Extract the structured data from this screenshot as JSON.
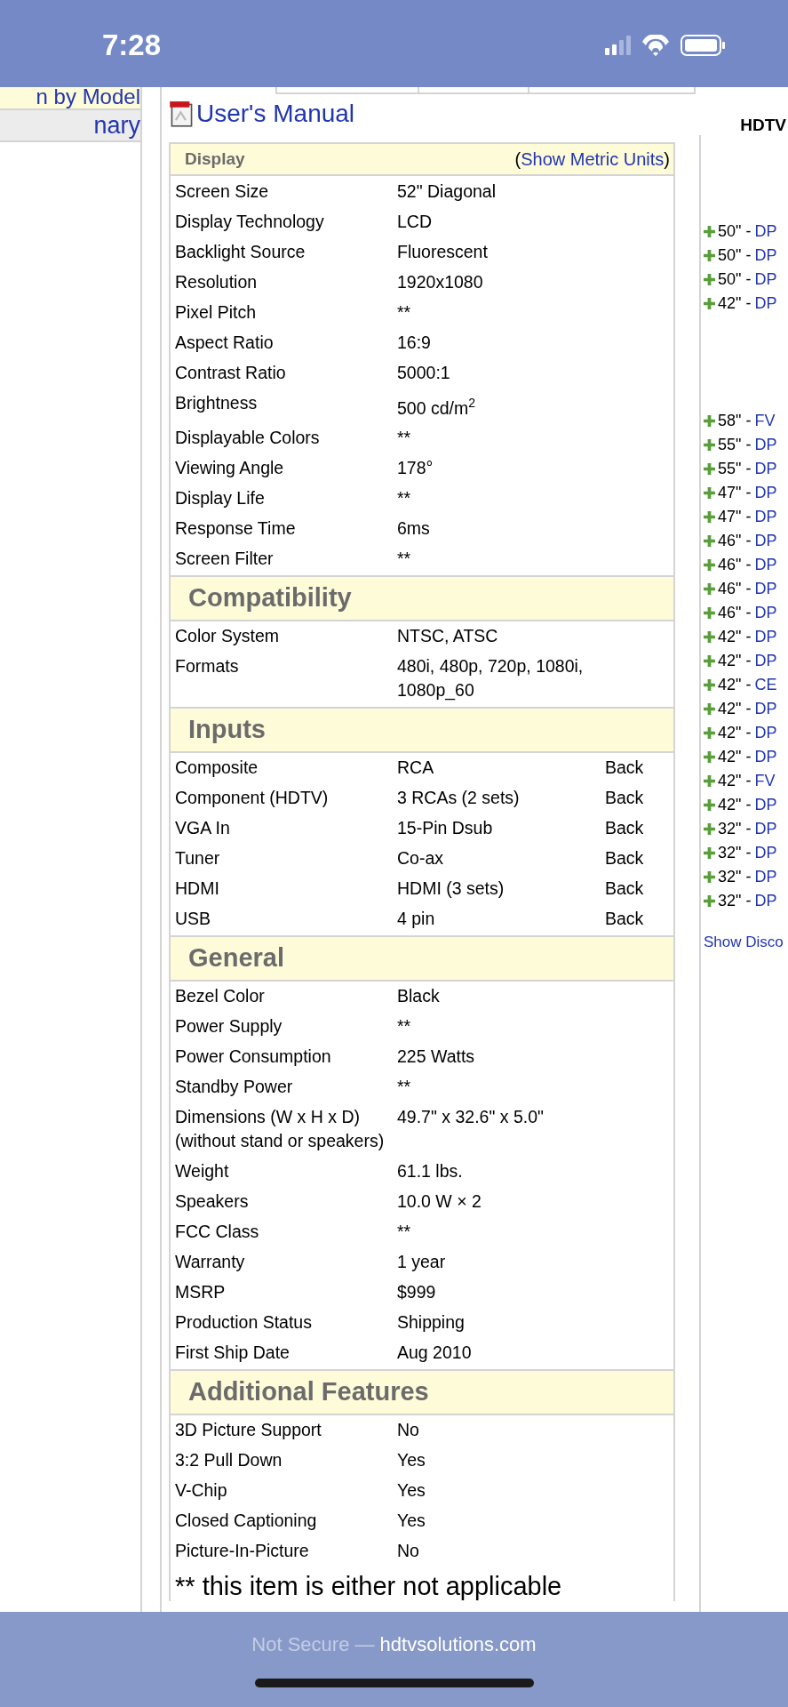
{
  "status_bar": {
    "time": "7:28"
  },
  "sidebar": {
    "items": [
      {
        "label": "n by Model",
        "selected": true
      },
      {
        "label": "nary",
        "selected": false
      }
    ]
  },
  "manual_link": "User's Manual",
  "sections": [
    {
      "title": "Display",
      "kind": "small",
      "action": {
        "before": "(",
        "link": "Show Metric Units",
        "after": ")"
      },
      "rows": [
        {
          "label": "Screen Size",
          "value": "52\" Diagonal"
        },
        {
          "label": "Display Technology",
          "value": "LCD"
        },
        {
          "label": "Backlight Source",
          "value": "Fluorescent"
        },
        {
          "label": "Resolution",
          "value": "1920x1080"
        },
        {
          "label": "Pixel Pitch",
          "value": "**"
        },
        {
          "label": "Aspect Ratio",
          "value": "16:9"
        },
        {
          "label": "Contrast Ratio",
          "value": "5000:1"
        },
        {
          "label": "Brightness",
          "value": "500 cd/m$^{2}$"
        },
        {
          "label": "Displayable Colors",
          "value": "**"
        },
        {
          "label": "Viewing Angle",
          "value": "178°"
        },
        {
          "label": "Display Life",
          "value": "**"
        },
        {
          "label": "Response Time",
          "value": "6ms"
        },
        {
          "label": "Screen Filter",
          "value": "**"
        }
      ]
    },
    {
      "title": "Compatibility",
      "kind": "large",
      "rows": [
        {
          "label": "Color System",
          "value": "NTSC, ATSC"
        },
        {
          "label": "Formats",
          "value": "480i, 480p, 720p, 1080i, 1080p_60"
        }
      ]
    },
    {
      "title": "Inputs",
      "kind": "large",
      "rows": [
        {
          "label": "Composite",
          "value": "RCA",
          "location": "Back"
        },
        {
          "label": "Component (HDTV)",
          "value": "3 RCAs (2 sets)",
          "location": "Back"
        },
        {
          "label": "VGA In",
          "value": "15-Pin Dsub",
          "location": "Back"
        },
        {
          "label": "Tuner",
          "value": "Co-ax",
          "location": "Back"
        },
        {
          "label": "HDMI",
          "value": "HDMI (3 sets)",
          "location": "Back"
        },
        {
          "label": "USB",
          "value": "4 pin",
          "location": "Back"
        }
      ]
    },
    {
      "title": "General",
      "kind": "large",
      "rows": [
        {
          "label": "Bezel Color",
          "value": "Black"
        },
        {
          "label": "Power Supply",
          "value": "**"
        },
        {
          "label": "Power Consumption",
          "value": "225 Watts"
        },
        {
          "label": "Standby Power",
          "value": "**"
        },
        {
          "label": "Dimensions (W x H x D) (without stand or speakers)",
          "value": "49.7\" x 32.6\" x 5.0\""
        },
        {
          "label": "Weight",
          "value": "61.1 lbs."
        },
        {
          "label": "Speakers",
          "value": "10.0 W × 2"
        },
        {
          "label": "FCC Class",
          "value": "**"
        },
        {
          "label": "Warranty",
          "value": "1 year"
        },
        {
          "label": "MSRP",
          "value": "$999"
        },
        {
          "label": "Production Status",
          "value": "Shipping"
        },
        {
          "label": "First Ship Date",
          "value": "Aug 2010"
        }
      ]
    },
    {
      "title": "Additional Features",
      "kind": "large",
      "rows": [
        {
          "label": "3D Picture Support",
          "value": "No"
        },
        {
          "label": "3:2 Pull Down",
          "value": "Yes"
        },
        {
          "label": "V-Chip",
          "value": "Yes"
        },
        {
          "label": "Closed Captioning",
          "value": "Yes"
        },
        {
          "label": "Picture-In-Picture",
          "value": "No"
        }
      ]
    }
  ],
  "footnote": "** this item is either not applicable",
  "related": {
    "title": "HDTV",
    "groups": [
      [
        {
          "size": "50\" -",
          "model": "DP"
        },
        {
          "size": "50\" -",
          "model": "DP"
        },
        {
          "size": "50\" -",
          "model": "DP"
        },
        {
          "size": "42\" -",
          "model": "DP"
        }
      ],
      [
        {
          "size": "58\" -",
          "model": "FV"
        },
        {
          "size": "55\" -",
          "model": "DP"
        },
        {
          "size": "55\" -",
          "model": "DP"
        },
        {
          "size": "47\" -",
          "model": "DP"
        },
        {
          "size": "47\" -",
          "model": "DP"
        },
        {
          "size": "46\" -",
          "model": "DP"
        },
        {
          "size": "46\" -",
          "model": "DP"
        },
        {
          "size": "46\" -",
          "model": "DP"
        },
        {
          "size": "46\" -",
          "model": "DP"
        },
        {
          "size": "42\" -",
          "model": "DP"
        },
        {
          "size": "42\" -",
          "model": "DP"
        },
        {
          "size": "42\" -",
          "model": "CE"
        },
        {
          "size": "42\" -",
          "model": "DP"
        },
        {
          "size": "42\" -",
          "model": "DP"
        },
        {
          "size": "42\" -",
          "model": "DP"
        },
        {
          "size": "42\" -",
          "model": "FV"
        },
        {
          "size": "42\" -",
          "model": "DP"
        },
        {
          "size": "32\" -",
          "model": "DP"
        },
        {
          "size": "32\" -",
          "model": "DP"
        },
        {
          "size": "32\" -",
          "model": "DP"
        },
        {
          "size": "32\" -",
          "model": "DP"
        }
      ]
    ],
    "more": "Show Disco"
  },
  "browser_bar": {
    "security": "Not Secure —",
    "domain": "hdtvsolutions.com"
  }
}
